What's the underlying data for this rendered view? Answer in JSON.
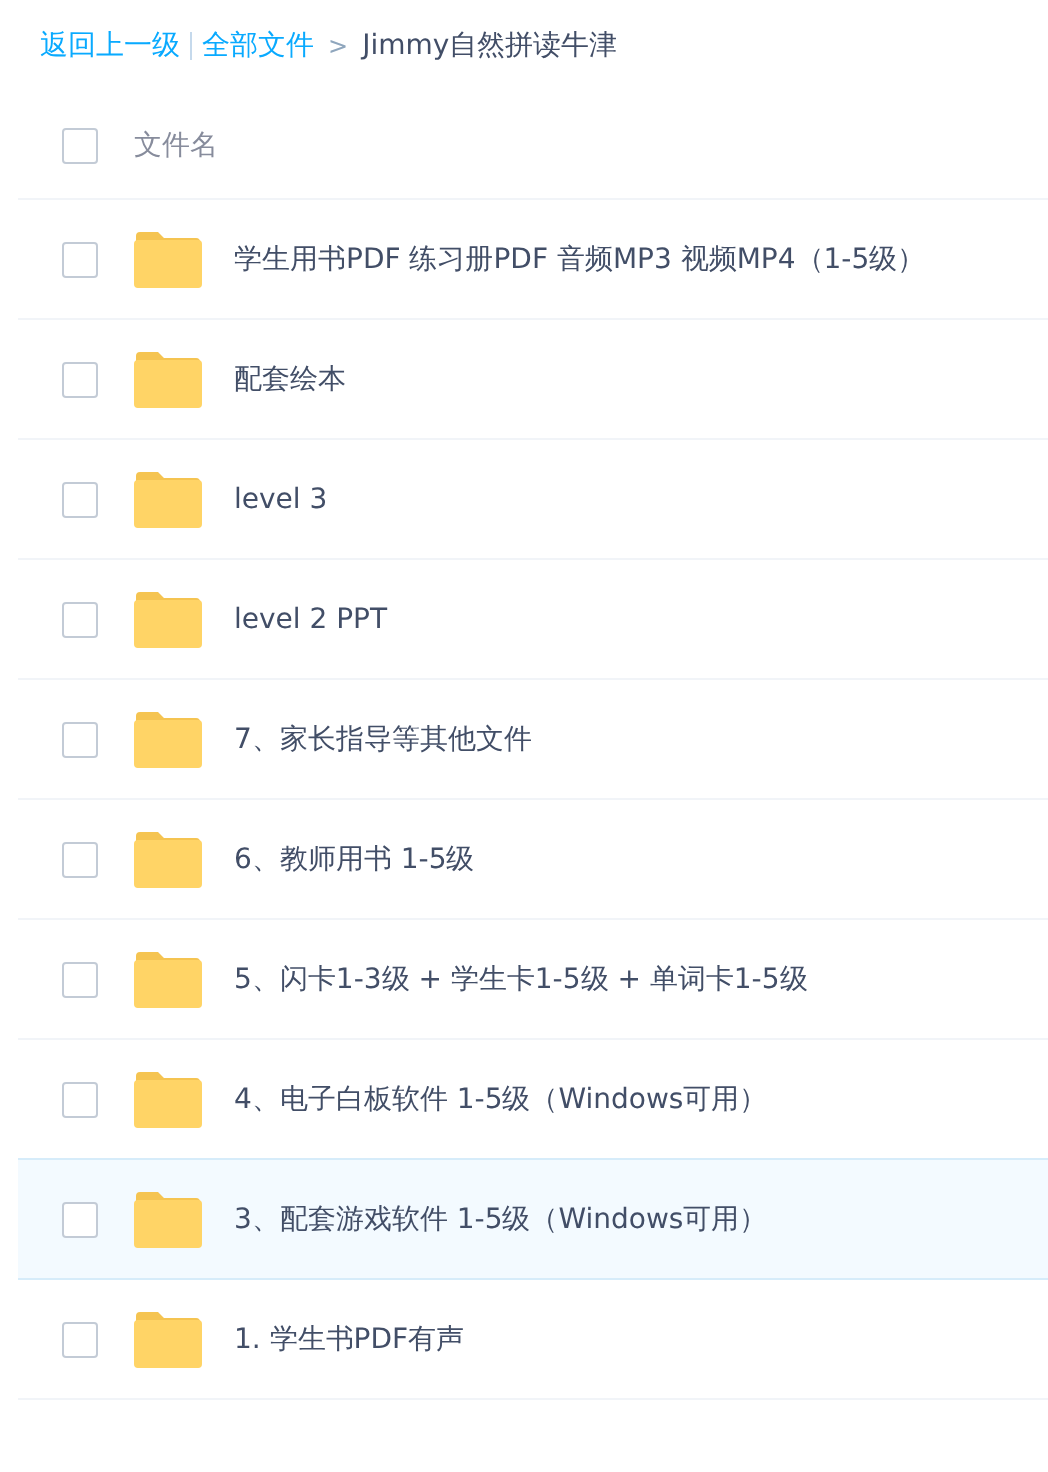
{
  "breadcrumb": {
    "back": "返回上一级",
    "root": "全部文件",
    "separator": ">",
    "current": "Jimmy自然拼读牛津"
  },
  "header": {
    "checked": false,
    "label": "文件名"
  },
  "rows": [
    {
      "name": "学生用书PDF 练习册PDF 音频MP3 视频MP4（1-5级）",
      "checked": false,
      "selected": false
    },
    {
      "name": "配套绘本",
      "checked": false,
      "selected": false
    },
    {
      "name": "level 3",
      "checked": false,
      "selected": false
    },
    {
      "name": "level 2 PPT",
      "checked": false,
      "selected": false
    },
    {
      "name": "7、家长指导等其他文件",
      "checked": false,
      "selected": false
    },
    {
      "name": "6、教师用书 1-5级",
      "checked": false,
      "selected": false
    },
    {
      "name": "5、闪卡1-3级 + 学生卡1-5级 + 单词卡1-5级",
      "checked": false,
      "selected": false
    },
    {
      "name": "4、电子白板软件 1-5级（Windows可用）",
      "checked": false,
      "selected": false
    },
    {
      "name": "3、配套游戏软件 1-5级（Windows可用）",
      "checked": false,
      "selected": true
    },
    {
      "name": "1. 学生书PDF有声",
      "checked": false,
      "selected": false
    }
  ]
}
